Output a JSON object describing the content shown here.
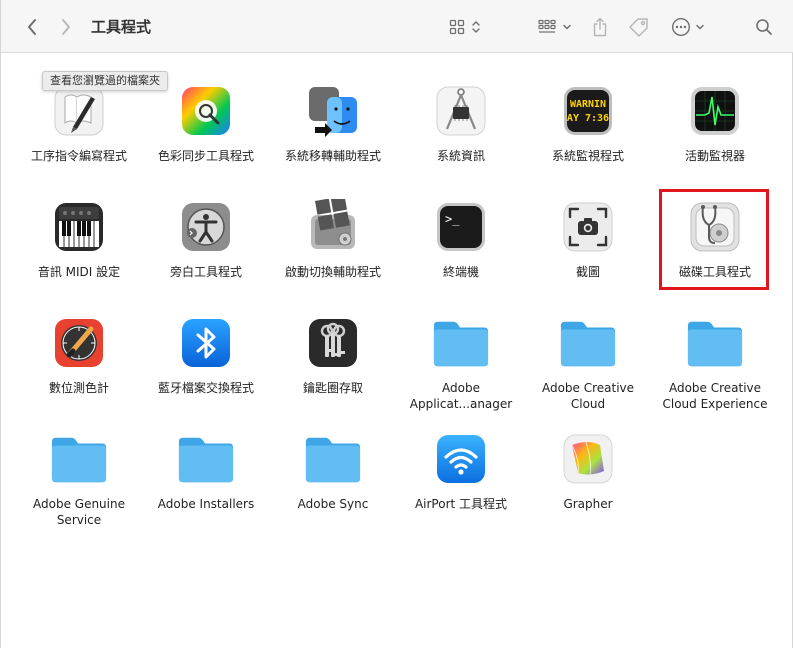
{
  "window": {
    "title": "工具程式"
  },
  "tooltip": "查看您瀏覽過的檔案夾",
  "items": [
    {
      "label": "工序指令編寫程式",
      "icon": "script-editor-icon"
    },
    {
      "label": "色彩同步工具程式",
      "icon": "colorsync-icon"
    },
    {
      "label": "系統移轉輔助程式",
      "icon": "migration-assistant-icon"
    },
    {
      "label": "系統資訊",
      "icon": "system-information-icon"
    },
    {
      "label": "系統監視程式",
      "icon": "console-icon",
      "text": "WARNIN AY 7:36"
    },
    {
      "label": "活動監視器",
      "icon": "activity-monitor-icon"
    },
    {
      "label": "音訊 MIDI 設定",
      "icon": "audio-midi-setup-icon"
    },
    {
      "label": "旁白工具程式",
      "icon": "voiceover-utility-icon"
    },
    {
      "label": "啟動切換輔助程式",
      "icon": "boot-camp-assistant-icon"
    },
    {
      "label": "終端機",
      "icon": "terminal-icon"
    },
    {
      "label": "截圖",
      "icon": "screenshot-icon"
    },
    {
      "label": "磁碟工具程式",
      "icon": "disk-utility-icon"
    },
    {
      "label": "數位測色計",
      "icon": "digital-color-meter-icon"
    },
    {
      "label": "藍牙檔案交換程式",
      "icon": "bluetooth-file-exchange-icon"
    },
    {
      "label": "鑰匙圈存取",
      "icon": "keychain-access-icon"
    },
    {
      "label": "Adobe Applicat...anager",
      "icon": "folder-icon"
    },
    {
      "label": "Adobe Creative Cloud",
      "icon": "folder-icon"
    },
    {
      "label": "Adobe Creative Cloud Experience",
      "icon": "folder-icon"
    },
    {
      "label": "Adobe Genuine Service",
      "icon": "folder-icon"
    },
    {
      "label": "Adobe Installers",
      "icon": "folder-icon"
    },
    {
      "label": "Adobe Sync",
      "icon": "folder-icon"
    },
    {
      "label": "AirPort 工具程式",
      "icon": "airport-utility-icon"
    },
    {
      "label": "Grapher",
      "icon": "grapher-icon"
    }
  ],
  "colors": {
    "folder": "#5cb8f0",
    "highlight": "#e1161d",
    "toolbar": "#f6f6f6"
  }
}
